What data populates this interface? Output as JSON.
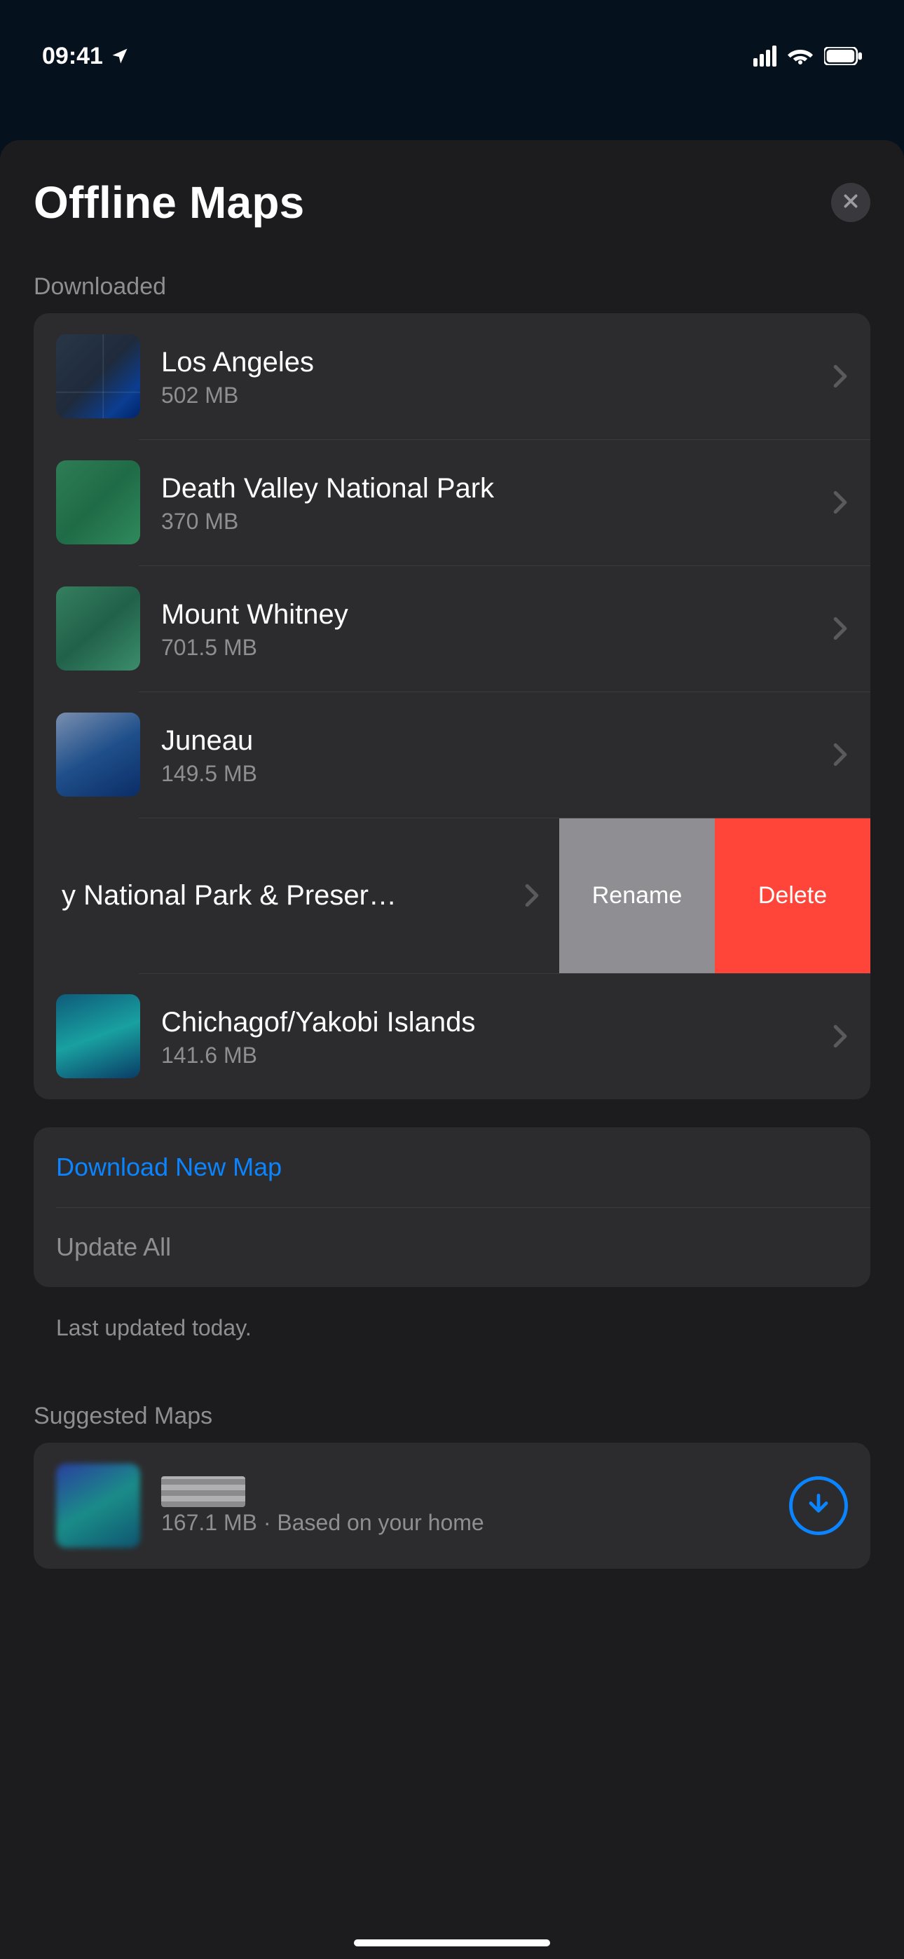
{
  "status": {
    "time": "09:41",
    "location_icon": "location-arrow"
  },
  "sheet": {
    "title": "Offline Maps",
    "close_icon": "xmark"
  },
  "sections": {
    "downloaded_label": "Downloaded",
    "suggested_label": "Suggested Maps"
  },
  "downloaded": [
    {
      "name": "Los Angeles",
      "size": "502 MB",
      "thumb": "la"
    },
    {
      "name": "Death Valley National Park",
      "size": "370 MB",
      "thumb": "green1"
    },
    {
      "name": "Mount Whitney",
      "size": "701.5 MB",
      "thumb": "green2"
    },
    {
      "name": "Juneau",
      "size": "149.5 MB",
      "thumb": "juneau"
    },
    {
      "name": "y National Park & Preser…",
      "size": "",
      "thumb": "",
      "swiped": true
    },
    {
      "name": "Chichagof/Yakobi Islands",
      "size": "141.6 MB",
      "thumb": "chich"
    }
  ],
  "swipe_actions": {
    "rename": "Rename",
    "delete": "Delete"
  },
  "actions": {
    "download_new_map": "Download New Map",
    "update_all": "Update All"
  },
  "footer_note": "Last updated today.",
  "suggested": [
    {
      "name": "",
      "detail": "167.1 MB · Based on your home",
      "thumb": "sugg"
    }
  ]
}
